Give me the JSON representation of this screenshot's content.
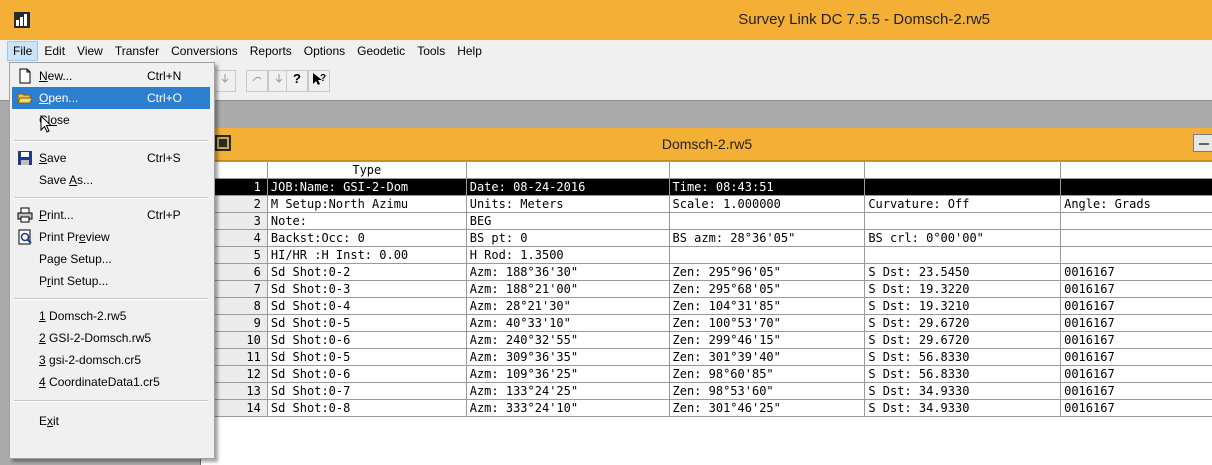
{
  "app": {
    "title": "Survey Link DC 7.5.5 - Domsch-2.rw5"
  },
  "menubar": {
    "items": [
      "File",
      "Edit",
      "View",
      "Transfer",
      "Conversions",
      "Reports",
      "Options",
      "Geodetic",
      "Tools",
      "Help"
    ]
  },
  "file_menu": {
    "new": {
      "label": "New...",
      "shortcut": "Ctrl+N",
      "icon": "new-document-icon"
    },
    "open": {
      "label": "Open...",
      "shortcut": "Ctrl+O",
      "icon": "open-folder-icon"
    },
    "close": {
      "label": "Close"
    },
    "save": {
      "label": "Save",
      "shortcut": "Ctrl+S",
      "icon": "floppy-disk-icon"
    },
    "save_as": {
      "label": "Save As..."
    },
    "print": {
      "label": "Print...",
      "shortcut": "Ctrl+P",
      "icon": "printer-icon"
    },
    "print_preview": {
      "label": "Print Preview",
      "icon": "print-preview-icon"
    },
    "page_setup": {
      "label": "Page Setup..."
    },
    "print_setup": {
      "label": "Print Setup..."
    },
    "recent": [
      "1 Domsch-2.rw5",
      "2 GSI-2-Domsch.rw5",
      "3 gsi-2-domsch.cr5",
      "4 CoordinateData1.cr5"
    ],
    "exit": {
      "label": "Exit"
    }
  },
  "document": {
    "title": "Domsch-2.rw5",
    "type_header": "Type",
    "rows": [
      {
        "n": "1",
        "c": [
          "JOB:Name: GSI-2-Dom",
          "Date: 08-24-2016",
          "Time: 08:43:51",
          "",
          ""
        ]
      },
      {
        "n": "2",
        "c": [
          "M Setup:North Azimu",
          "Units: Meters",
          "Scale: 1.000000",
          "Curvature: Off",
          "Angle: Grads"
        ]
      },
      {
        "n": "3",
        "c": [
          "Note:",
          "BEG",
          "",
          "",
          ""
        ]
      },
      {
        "n": "4",
        "c": [
          "Backst:Occ: 0",
          "BS pt: 0",
          "BS azm: 28°36'05\"",
          "BS crl: 0°00'00\"",
          ""
        ]
      },
      {
        "n": "5",
        "c": [
          "HI/HR :H Inst: 0.00",
          "H Rod: 1.3500",
          "",
          "",
          ""
        ]
      },
      {
        "n": "6",
        "c": [
          "Sd Shot:0-2",
          "Azm: 188°36'30\"",
          "Zen: 295°96'05\"",
          "S Dst: 23.5450",
          "0016167"
        ]
      },
      {
        "n": "7",
        "c": [
          "Sd Shot:0-3",
          "Azm: 188°21'00\"",
          "Zen: 295°68'05\"",
          "S Dst: 19.3220",
          "0016167"
        ]
      },
      {
        "n": "8",
        "c": [
          "Sd Shot:0-4",
          "Azm: 28°21'30\"",
          "Zen: 104°31'85\"",
          "S Dst: 19.3210",
          "0016167"
        ]
      },
      {
        "n": "9",
        "c": [
          "Sd Shot:0-5",
          "Azm: 40°33'10\"",
          "Zen: 100°53'70\"",
          "S Dst: 29.6720",
          "0016167"
        ]
      },
      {
        "n": "10",
        "c": [
          "Sd Shot:0-6",
          "Azm: 240°32'55\"",
          "Zen: 299°46'15\"",
          "S Dst: 29.6720",
          "0016167"
        ]
      },
      {
        "n": "11",
        "c": [
          "Sd Shot:0-5",
          "Azm: 309°36'35\"",
          "Zen: 301°39'40\"",
          "S Dst: 56.8330",
          "0016167"
        ]
      },
      {
        "n": "12",
        "c": [
          "Sd Shot:0-6",
          "Azm: 109°36'25\"",
          "Zen: 98°60'85\"",
          "S Dst: 56.8330",
          "0016167"
        ]
      },
      {
        "n": "13",
        "c": [
          "Sd Shot:0-7",
          "Azm: 133°24'25\"",
          "Zen: 98°53'60\"",
          "S Dst: 34.9330",
          "0016167"
        ]
      },
      {
        "n": "14",
        "c": [
          "Sd Shot:0-8",
          "Azm: 333°24'10\"",
          "Zen: 301°46'25\"",
          "S Dst: 34.9330",
          "0016167"
        ]
      }
    ]
  },
  "colors": {
    "titlebar": "#f4b036",
    "highlight": "#2c7fd0"
  }
}
